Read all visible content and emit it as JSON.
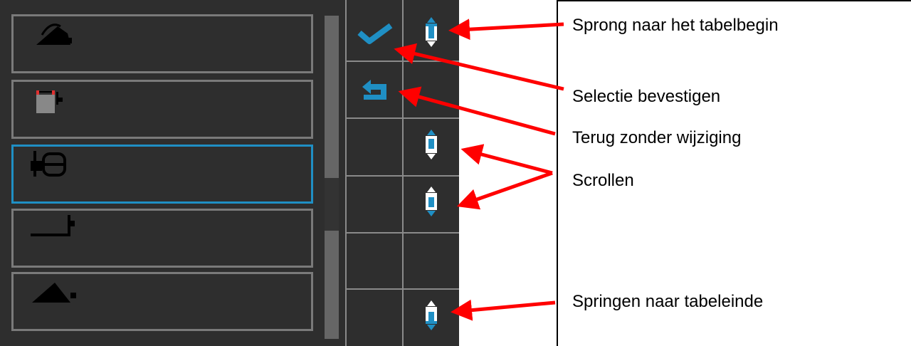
{
  "list": {
    "items": [
      {
        "icon": "silo-icon",
        "selected": false
      },
      {
        "icon": "bin-icon",
        "selected": false
      },
      {
        "icon": "round-baler-icon",
        "selected": true
      },
      {
        "icon": "platform-icon",
        "selected": false
      },
      {
        "icon": "heap-icon",
        "selected": false
      }
    ]
  },
  "softkeys": [
    {
      "icon": "checkmark-icon",
      "function": "confirm"
    },
    {
      "icon": "jump-to-start-icon",
      "function": "jump-start"
    },
    {
      "icon": "back-icon",
      "function": "back"
    },
    {
      "icon": "scroll-up-icon",
      "function": "scroll-up"
    },
    {
      "icon": "scroll-down-icon",
      "function": "scroll-down"
    },
    {
      "icon": "jump-to-end-icon",
      "function": "jump-end"
    }
  ],
  "callouts": {
    "jump_start": "Sprong naar het tabelbegin",
    "confirm": "Selectie bevestigen",
    "back": "Terug zonder wijziging",
    "scroll": "Scrollen",
    "jump_end": "Springen naar tabeleinde"
  },
  "colors": {
    "accent": "#1f8fc4",
    "arrow": "#ff0000",
    "background": "#2e2e2e"
  }
}
